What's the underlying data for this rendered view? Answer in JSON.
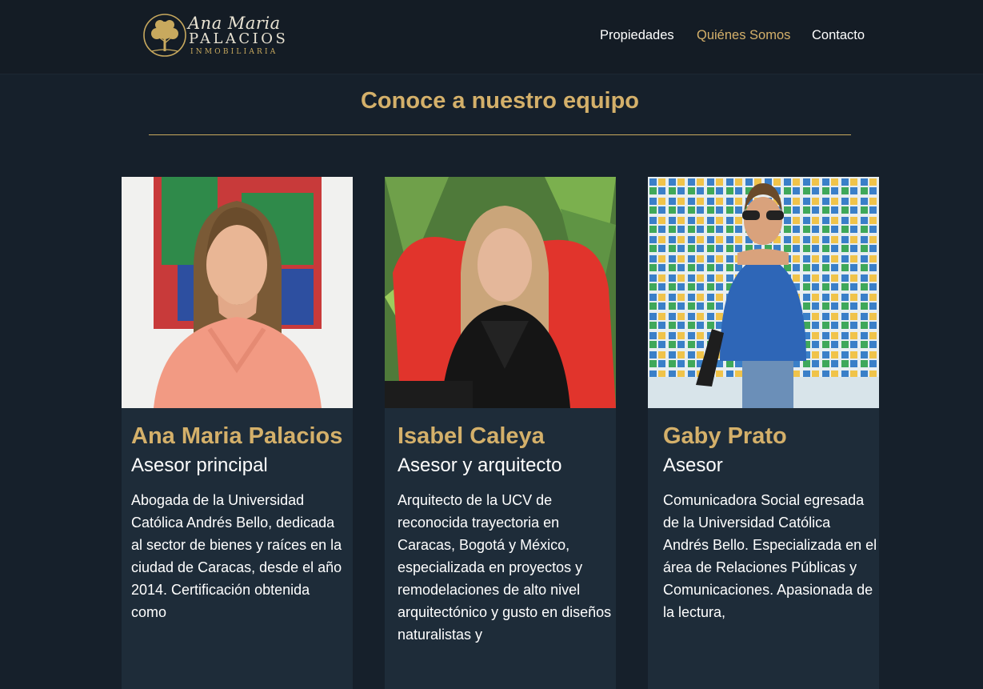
{
  "brand": {
    "script": "Ana Maria",
    "main": "PALACIOS",
    "sub": "INMOBILIARIA",
    "tree_icon": "tree-icon",
    "color": "#c8a95e"
  },
  "nav": {
    "items": [
      {
        "label": "Propiedades",
        "active": false
      },
      {
        "label": "Quiénes Somos",
        "active": true
      },
      {
        "label": "Contacto",
        "active": false
      }
    ]
  },
  "team": {
    "title": "Conoce a nuestro equipo",
    "members": [
      {
        "name": "Ana Maria Palacios",
        "role": "Asesor principal",
        "bio": "Abogada de la Universidad Católica Andrés Bello, dedicada al sector de bienes y raíces en la ciudad de Caracas, desde el año 2014. Certificación obtenida como"
      },
      {
        "name": "Isabel Caleya",
        "role": "Asesor y arquitecto",
        "bio": "Arquitecto de la UCV de reconocida trayectoria en Caracas, Bogotá y México, especializada en proyectos y remodelaciones de alto nivel arquitectónico y gusto en diseños naturalistas y"
      },
      {
        "name": "Gaby Prato",
        "role": "Asesor",
        "bio": "Comunicadora Social egresada de la Universidad Católica Andrés Bello. Especializada en el área de Relaciones Públicas y Comunicaciones. Apasionada de la lectura,"
      }
    ]
  },
  "colors": {
    "accent": "#d4b06a",
    "background": "#16202b",
    "header": "#141c25",
    "card": "#1e2c39"
  }
}
